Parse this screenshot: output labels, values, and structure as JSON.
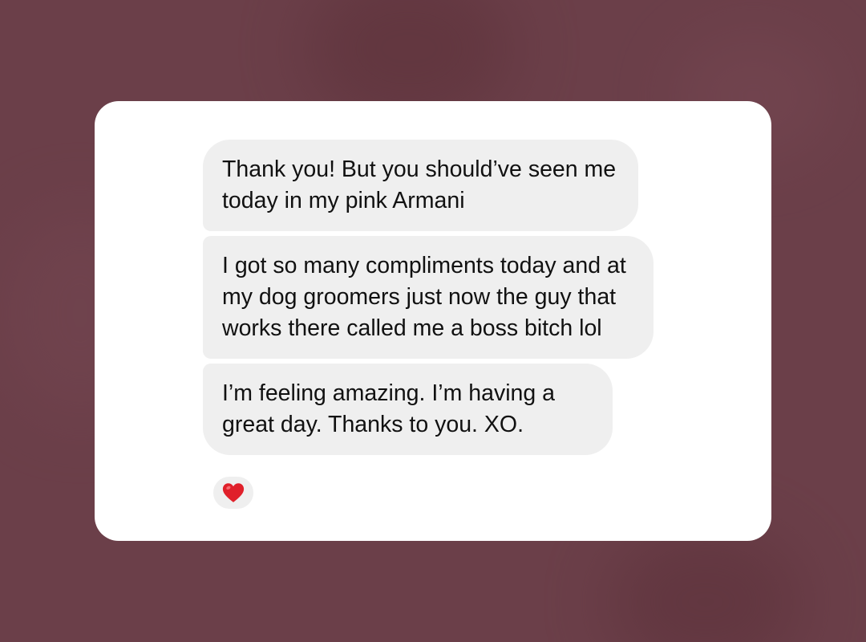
{
  "messages": [
    {
      "text": "Thank you! But you should’ve seen me today in my pink Armani"
    },
    {
      "text": "I got so many compliments today and at my dog groomers just now the guy that works there called me a boss bitch lol"
    },
    {
      "text": "I’m feeling amazing. I’m having a great day. Thanks to you. XO."
    }
  ],
  "reaction": {
    "icon": "red-heart-icon",
    "color": "#e0202a"
  },
  "colors": {
    "background": "#6b3f49",
    "card": "#ffffff",
    "bubble": "#efefef",
    "text": "#111111"
  }
}
